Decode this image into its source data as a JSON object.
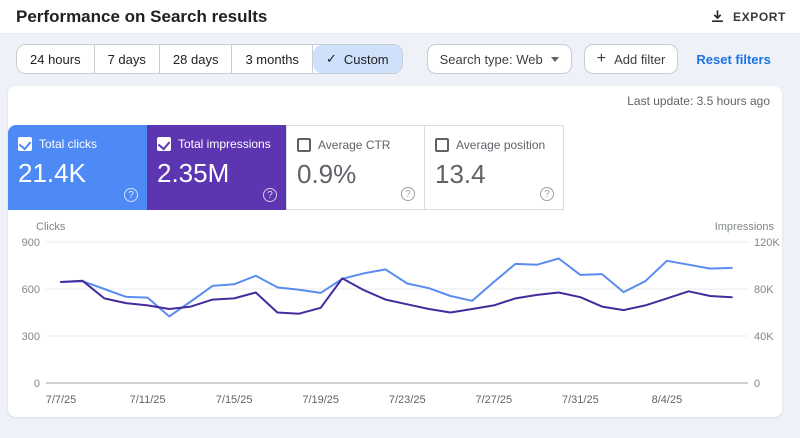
{
  "header": {
    "title": "Performance on Search results",
    "export_label": "EXPORT"
  },
  "toolbar": {
    "ranges": [
      "24 hours",
      "7 days",
      "28 days",
      "3 months",
      "Custom"
    ],
    "selected_range": "Custom",
    "check_glyph": "✓",
    "search_type_label": "Search type: Web",
    "add_filter_label": "Add filter",
    "plus_glyph": "+",
    "reset_filters_label": "Reset filters"
  },
  "status": {
    "last_update": "Last update: 3.5 hours ago"
  },
  "metrics": [
    {
      "label": "Total clicks",
      "value": "21.4K",
      "checked": true,
      "selected": true,
      "color": "#4d8af5"
    },
    {
      "label": "Total impressions",
      "value": "2.35M",
      "checked": true,
      "selected": true,
      "color": "#5c35b0"
    },
    {
      "label": "Average CTR",
      "value": "0.9%",
      "checked": false,
      "selected": false,
      "color": "#ffffff"
    },
    {
      "label": "Average position",
      "value": "13.4",
      "checked": false,
      "selected": false,
      "color": "#ffffff"
    }
  ],
  "help_glyph": "?",
  "chart_data": {
    "type": "line",
    "x_labels": [
      "7/7/25",
      "7/11/25",
      "7/15/25",
      "7/19/25",
      "7/23/25",
      "7/27/25",
      "7/31/25",
      "8/4/25"
    ],
    "x_label_step_days": 4,
    "left_axis": {
      "title": "Clicks",
      "ticks": [
        "900",
        "600",
        "300",
        "0"
      ],
      "max": 900
    },
    "right_axis": {
      "title": "Impressions",
      "ticks": [
        "120K",
        "80K",
        "40K",
        "0"
      ],
      "max": 120000
    },
    "grid": "horizontal",
    "series": [
      {
        "name": "Total clicks",
        "axis": "left",
        "color": "#5a8cf0",
        "values": [
          645,
          650,
          600,
          550,
          545,
          425,
          520,
          620,
          630,
          685,
          610,
          595,
          575,
          665,
          700,
          725,
          635,
          605,
          555,
          525,
          645,
          760,
          755,
          795,
          690,
          695,
          580,
          650,
          780,
          755,
          730,
          735
        ]
      },
      {
        "name": "Total impressions",
        "axis": "right",
        "color": "#452b9d",
        "values": [
          86000,
          87000,
          72000,
          68000,
          66000,
          63000,
          65000,
          71000,
          72000,
          77000,
          60000,
          59000,
          64000,
          89000,
          79000,
          71000,
          67000,
          63000,
          60000,
          63000,
          66000,
          72000,
          75000,
          77000,
          73000,
          65000,
          62000,
          66000,
          72000,
          78000,
          74000,
          73000
        ]
      }
    ]
  }
}
